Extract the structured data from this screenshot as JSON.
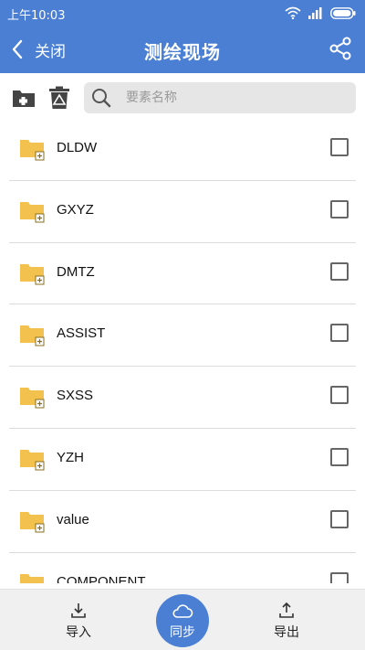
{
  "status_bar": {
    "time": "上午10:03"
  },
  "header": {
    "back_label": "关闭",
    "title": "测绘现场"
  },
  "toolbar": {
    "search_placeholder": "要素名称"
  },
  "list": {
    "items": [
      {
        "name": "DLDW"
      },
      {
        "name": "GXYZ"
      },
      {
        "name": "DMTZ"
      },
      {
        "name": "ASSIST"
      },
      {
        "name": "SXSS"
      },
      {
        "name": "YZH"
      },
      {
        "name": "value"
      },
      {
        "name": "COMPONENT"
      }
    ]
  },
  "bottom_bar": {
    "import_label": "导入",
    "sync_label": "同步",
    "export_label": "导出"
  },
  "colors": {
    "primary": "#4a7fd4",
    "folder": "#f2c14e",
    "bottom_bg": "#f0f0f0"
  }
}
